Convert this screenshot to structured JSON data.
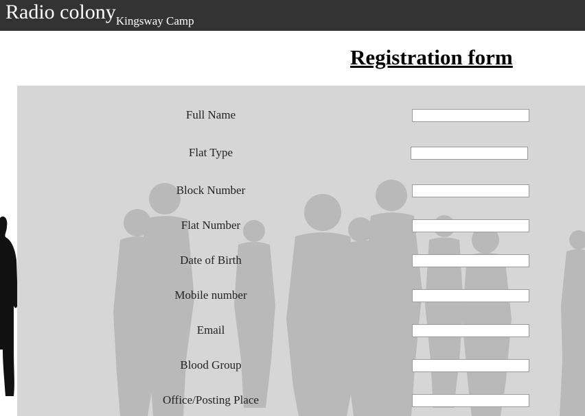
{
  "header": {
    "title": "Radio colony",
    "subtitle": "Kingsway Camp"
  },
  "form": {
    "heading": "Registration form",
    "fields": [
      {
        "label": "Full Name",
        "value": "",
        "placeholder": ""
      },
      {
        "label": "Flat Type",
        "value": "",
        "placeholder": ""
      },
      {
        "label": "Block Number",
        "value": "",
        "placeholder": ""
      },
      {
        "label": "Flat Number",
        "value": "",
        "placeholder": ""
      },
      {
        "label": "Date of Birth",
        "value": "",
        "placeholder": ""
      },
      {
        "label": "Mobile number",
        "value": "",
        "placeholder": ""
      },
      {
        "label": "Email",
        "value": "",
        "placeholder": ""
      },
      {
        "label": "Blood Group",
        "value": "",
        "placeholder": ""
      },
      {
        "label": "Office/Posting Place",
        "value": "",
        "placeholder": ""
      }
    ]
  },
  "colors": {
    "header_bg": "#333333",
    "form_bg": "#d6d6d6",
    "silhouettes": "#b8b8b8"
  },
  "background_image": "crowd-silhouette"
}
